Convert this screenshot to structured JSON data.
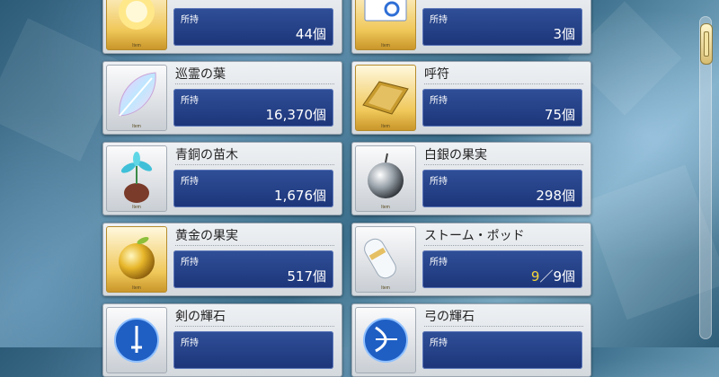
{
  "holding_label": "所持",
  "item_tag": "Item",
  "counter_suffix": "個",
  "items": [
    {
      "name": "",
      "quantity": "44個",
      "thumb_icon": "sun-icon"
    },
    {
      "name": "",
      "quantity": "3個",
      "thumb_icon": "ticket-icon"
    },
    {
      "name": "巡霊の葉",
      "quantity": "16,370個",
      "thumb_icon": "leaf-icon"
    },
    {
      "name": "呼符",
      "quantity": "75個",
      "thumb_icon": "summon-ticket-icon"
    },
    {
      "name": "青銅の苗木",
      "quantity": "1,676個",
      "thumb_icon": "sapling-icon"
    },
    {
      "name": "白銀の果実",
      "quantity": "298個",
      "thumb_icon": "silver-apple-icon"
    },
    {
      "name": "黄金の果実",
      "quantity": "517個",
      "thumb_icon": "golden-apple-icon"
    },
    {
      "name": "ストーム・ポッド",
      "quantity_current": "9",
      "quantity_rest": "／9個",
      "thumb_icon": "storm-pod-icon"
    },
    {
      "name": "剣の輝石",
      "quantity": "",
      "thumb_icon": "saber-gem-icon"
    },
    {
      "name": "弓の輝石",
      "quantity": "",
      "thumb_icon": "archer-gem-icon"
    }
  ],
  "colors": {
    "plate": "#23408a",
    "highlight_quantity": "#f3d53a",
    "gold_frame": "#f0c85a"
  }
}
